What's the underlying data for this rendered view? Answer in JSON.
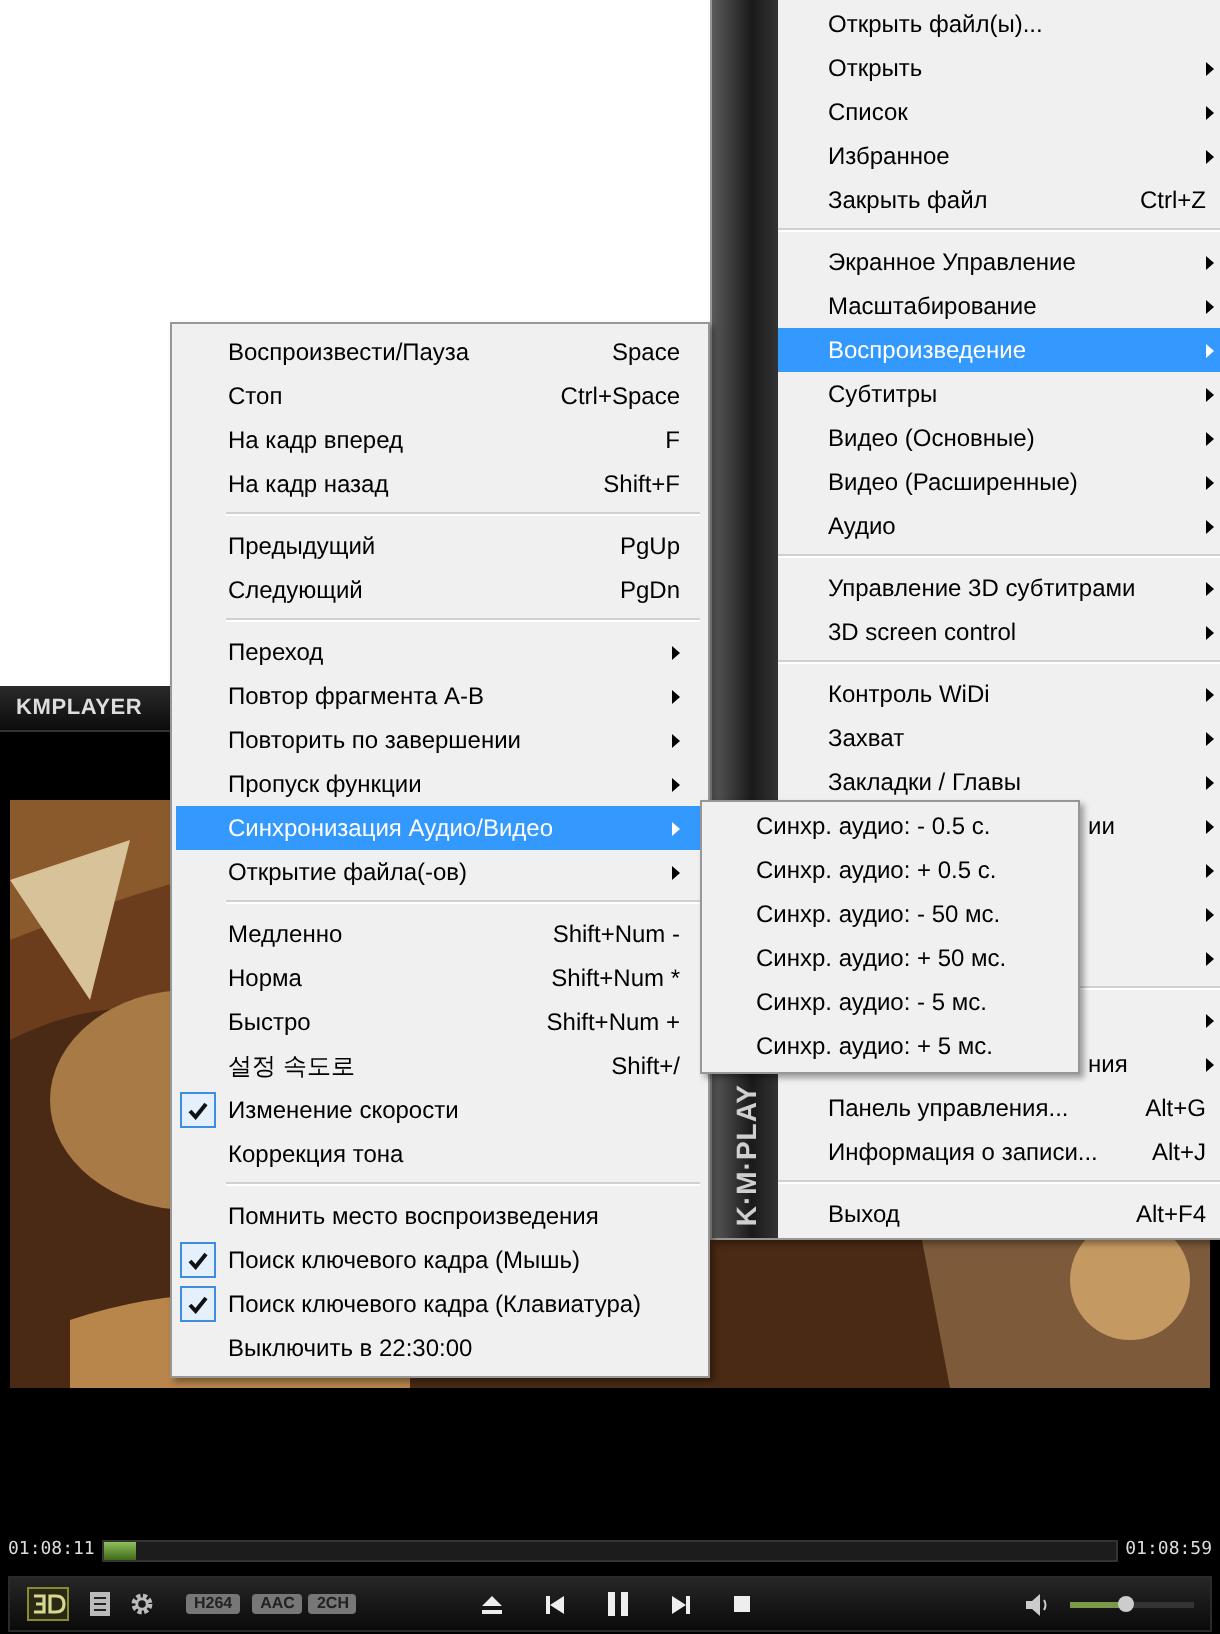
{
  "main_menu": {
    "strip_text": "K·M·PLAY",
    "items": [
      {
        "kind": "item",
        "label": "Открыть файл(ы)..."
      },
      {
        "kind": "item",
        "label": "Открыть",
        "submenu": true
      },
      {
        "kind": "item",
        "label": "Список",
        "submenu": true
      },
      {
        "kind": "item",
        "label": "Избранное",
        "submenu": true
      },
      {
        "kind": "item",
        "label": "Закрыть файл",
        "shortcut": "Ctrl+Z"
      },
      {
        "kind": "separator"
      },
      {
        "kind": "item",
        "label": "Экранное Управление",
        "submenu": true
      },
      {
        "kind": "item",
        "label": "Масштабирование",
        "submenu": true
      },
      {
        "kind": "item",
        "label": "Воспроизведение",
        "submenu": true,
        "selected": true
      },
      {
        "kind": "item",
        "label": "Субтитры",
        "submenu": true
      },
      {
        "kind": "item",
        "label": "Видео (Основные)",
        "submenu": true
      },
      {
        "kind": "item",
        "label": "Видео (Расширенные)",
        "submenu": true
      },
      {
        "kind": "item",
        "label": "Аудио",
        "submenu": true
      },
      {
        "kind": "separator"
      },
      {
        "kind": "item",
        "label": "Управление 3D субтитрами",
        "submenu": true
      },
      {
        "kind": "item",
        "label": "3D screen control",
        "submenu": true
      },
      {
        "kind": "separator"
      },
      {
        "kind": "item",
        "label": "Контроль WiDi",
        "submenu": true
      },
      {
        "kind": "item",
        "label": "Захват",
        "submenu": true
      },
      {
        "kind": "item",
        "label": "Закладки / Главы",
        "submenu": true
      },
      {
        "kind": "covered",
        "label": "ии",
        "submenu": true
      },
      {
        "kind": "covered",
        "submenu": true
      },
      {
        "kind": "covered",
        "submenu": true
      },
      {
        "kind": "covered",
        "submenu": true
      },
      {
        "kind": "separator"
      },
      {
        "kind": "covered",
        "submenu": true
      },
      {
        "kind": "covered",
        "label": "ния",
        "submenu": true
      },
      {
        "kind": "item",
        "label": "Панель управления...",
        "shortcut": "Alt+G"
      },
      {
        "kind": "item",
        "label": "Информация о записи...",
        "shortcut": "Alt+J"
      },
      {
        "kind": "separator"
      },
      {
        "kind": "item",
        "label": "Выход",
        "shortcut": "Alt+F4"
      }
    ]
  },
  "playback_menu": {
    "items": [
      {
        "kind": "item",
        "label": "Воспроизвести/Пауза",
        "shortcut": "Space"
      },
      {
        "kind": "item",
        "label": "Стоп",
        "shortcut": "Ctrl+Space"
      },
      {
        "kind": "item",
        "label": "На кадр вперед",
        "shortcut": "F"
      },
      {
        "kind": "item",
        "label": "На кадр назад",
        "shortcut": "Shift+F"
      },
      {
        "kind": "separator"
      },
      {
        "kind": "item",
        "label": "Предыдущий",
        "shortcut": "PgUp"
      },
      {
        "kind": "item",
        "label": "Следующий",
        "shortcut": "PgDn"
      },
      {
        "kind": "separator"
      },
      {
        "kind": "item",
        "label": "Переход",
        "submenu": true
      },
      {
        "kind": "item",
        "label": "Повтор фрагмента A-B",
        "submenu": true
      },
      {
        "kind": "item",
        "label": "Повторить по завершении",
        "submenu": true
      },
      {
        "kind": "item",
        "label": "Пропуск функции",
        "submenu": true
      },
      {
        "kind": "item",
        "label": "Синхронизация Аудио/Видео",
        "submenu": true,
        "selected": true
      },
      {
        "kind": "item",
        "label": "Открытие файла(-ов)",
        "submenu": true
      },
      {
        "kind": "separator"
      },
      {
        "kind": "item",
        "label": "Медленно",
        "shortcut": "Shift+Num -"
      },
      {
        "kind": "item",
        "label": "Норма",
        "shortcut": "Shift+Num *"
      },
      {
        "kind": "item",
        "label": "Быстро",
        "shortcut": "Shift+Num +"
      },
      {
        "kind": "item",
        "label": "설정 속도로",
        "shortcut": "Shift+/"
      },
      {
        "kind": "check",
        "label": "Изменение скорости",
        "checked": true
      },
      {
        "kind": "check",
        "label": "Коррекция тона",
        "checked": false
      },
      {
        "kind": "separator"
      },
      {
        "kind": "check",
        "label": "Помнить место воспроизведения",
        "checked": false
      },
      {
        "kind": "check",
        "label": "Поиск ключевого кадра (Мышь)",
        "checked": true
      },
      {
        "kind": "check",
        "label": "Поиск ключевого кадра (Клавиатура)",
        "checked": true
      },
      {
        "kind": "check",
        "label": "Выключить в 22:30:00",
        "checked": false
      }
    ]
  },
  "sync_menu": {
    "items": [
      {
        "kind": "item",
        "label": "Синхр. аудио: - 0.5 с."
      },
      {
        "kind": "item",
        "label": "Синхр. аудио: + 0.5 с."
      },
      {
        "kind": "item",
        "label": "Синхр. аудио: - 50 мс."
      },
      {
        "kind": "item",
        "label": "Синхр. аудио: + 50 мс."
      },
      {
        "kind": "item",
        "label": "Синхр. аудио: - 5 мс."
      },
      {
        "kind": "item",
        "label": "Синхр. аудио: + 5 мс."
      }
    ]
  },
  "player": {
    "logo": "KMPLAYER",
    "elapsed": "01:08:11",
    "total": "01:08:59",
    "progress": {
      "level": 0.03
    },
    "badges": [
      "H264",
      "AAC",
      "2CH"
    ],
    "volume": {
      "level": 0.45
    }
  }
}
